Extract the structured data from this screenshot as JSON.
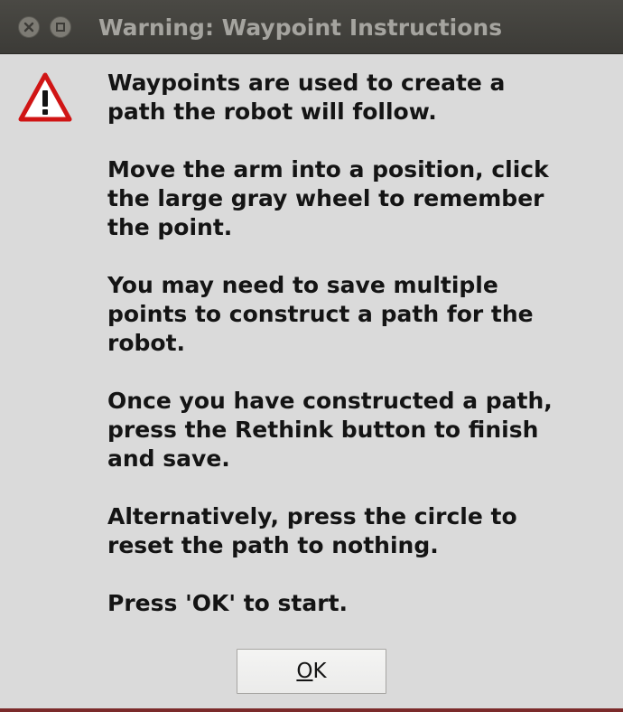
{
  "window": {
    "title": "Warning: Waypoint Instructions"
  },
  "icons": {
    "warning": "warning-icon",
    "close": "close-icon",
    "maximize": "maximize-icon"
  },
  "message": {
    "paragraphs": [
      "Waypoints are used to create a\npath the robot will follow.",
      "Move the arm into a position, click\nthe large gray wheel to remember\nthe point.",
      "You may need to save multiple\npoints to construct a path for the\nrobot.",
      "Once you have constructed a path,\npress the Rethink button to finish\nand save.",
      "Alternatively, press the circle to\nreset the path to nothing.",
      "Press 'OK' to start."
    ]
  },
  "buttons": {
    "ok_mnemonic": "O",
    "ok_rest": "K"
  },
  "colors": {
    "titlebar": "#3c3b37",
    "dialog_bg": "#dadada",
    "warning_red": "#d01515"
  }
}
